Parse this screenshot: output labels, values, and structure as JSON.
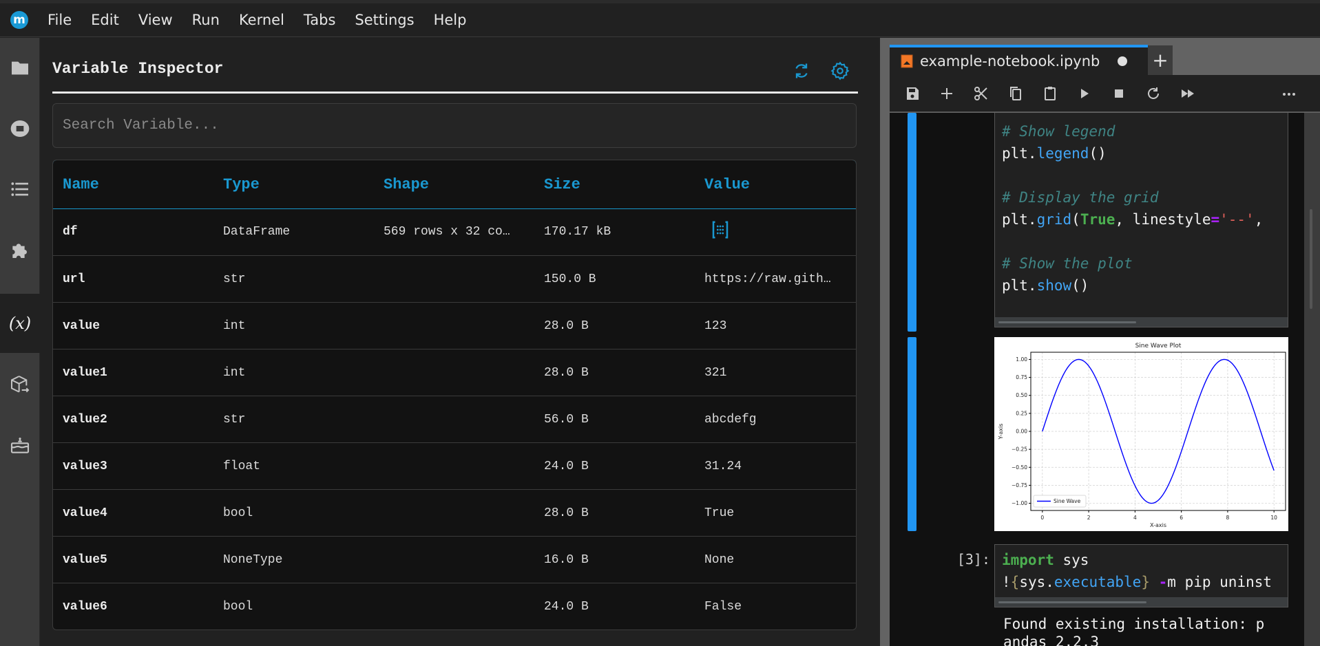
{
  "app": {
    "logo_letter": "m",
    "menu": [
      "File",
      "Edit",
      "View",
      "Run",
      "Kernel",
      "Tabs",
      "Settings",
      "Help"
    ]
  },
  "activity_bar": {
    "items": [
      {
        "icon": "folder-icon",
        "active": false
      },
      {
        "icon": "running-stop-icon",
        "active": false
      },
      {
        "icon": "table-of-contents-icon",
        "active": false
      },
      {
        "icon": "extension-puzzle-icon",
        "active": false
      },
      {
        "icon": "variable-inspector-icon",
        "label": "(x)",
        "active": true
      },
      {
        "icon": "package-export-icon",
        "active": false
      },
      {
        "icon": "cake-icon",
        "active": false
      }
    ]
  },
  "inspector": {
    "title": "Variable Inspector",
    "search_placeholder": "Search Variable...",
    "search_value": "",
    "accent": "#1a98d0",
    "columns": [
      "Name",
      "Type",
      "Shape",
      "Size",
      "Value"
    ],
    "rows": [
      {
        "name": "df",
        "type": "DataFrame",
        "shape": "569 rows x 32 co…",
        "size": "170.17 kB",
        "value": "",
        "value_icon": "matrix-icon"
      },
      {
        "name": "url",
        "type": "str",
        "shape": "",
        "size": "150.0 B",
        "value": "https://raw.gith…"
      },
      {
        "name": "value",
        "type": "int",
        "shape": "",
        "size": "28.0 B",
        "value": "123"
      },
      {
        "name": "value1",
        "type": "int",
        "shape": "",
        "size": "28.0 B",
        "value": "321"
      },
      {
        "name": "value2",
        "type": "str",
        "shape": "",
        "size": "56.0 B",
        "value": "abcdefg"
      },
      {
        "name": "value3",
        "type": "float",
        "shape": "",
        "size": "24.0 B",
        "value": "31.24"
      },
      {
        "name": "value4",
        "type": "bool",
        "shape": "",
        "size": "28.0 B",
        "value": "True"
      },
      {
        "name": "value5",
        "type": "NoneType",
        "shape": "",
        "size": "16.0 B",
        "value": "None"
      },
      {
        "name": "value6",
        "type": "bool",
        "shape": "",
        "size": "24.0 B",
        "value": "False"
      }
    ]
  },
  "notebook": {
    "tab_label": "example-notebook.ipynb",
    "tab_unsaved": true,
    "add_tab_label": "+",
    "toolbar": [
      "save",
      "insert-cell",
      "cut",
      "copy",
      "paste",
      "run",
      "stop",
      "restart",
      "run-all",
      "more"
    ],
    "cell1_code": [
      {
        "parts": [
          {
            "t": "# Show legend",
            "c": "comment"
          }
        ]
      },
      {
        "parts": [
          {
            "t": "plt.",
            "c": ""
          },
          {
            "t": "legend",
            "c": "prop"
          },
          {
            "t": "()",
            "c": ""
          }
        ]
      },
      {
        "parts": [
          {
            "t": "",
            "c": ""
          }
        ]
      },
      {
        "parts": [
          {
            "t": "# Display the grid",
            "c": "comment"
          }
        ]
      },
      {
        "parts": [
          {
            "t": "plt.",
            "c": ""
          },
          {
            "t": "grid",
            "c": "prop"
          },
          {
            "t": "(",
            "c": ""
          },
          {
            "t": "True",
            "c": "kw"
          },
          {
            "t": ", linestyle",
            "c": ""
          },
          {
            "t": "=",
            "c": "op"
          },
          {
            "t": "'--'",
            "c": "str"
          },
          {
            "t": ",",
            "c": ""
          }
        ]
      },
      {
        "parts": [
          {
            "t": "",
            "c": ""
          }
        ]
      },
      {
        "parts": [
          {
            "t": "# Show the plot",
            "c": "comment"
          }
        ]
      },
      {
        "parts": [
          {
            "t": "plt.",
            "c": ""
          },
          {
            "t": "show",
            "c": "prop"
          },
          {
            "t": "()",
            "c": ""
          }
        ]
      }
    ],
    "cell3_prompt": "[3]:",
    "cell3_code": [
      {
        "parts": [
          {
            "t": "import",
            "c": "kw"
          },
          {
            "t": " sys",
            "c": ""
          }
        ]
      },
      {
        "parts": [
          {
            "t": "!",
            "c": ""
          },
          {
            "t": "{",
            "c": "brace"
          },
          {
            "t": "sys.",
            "c": ""
          },
          {
            "t": "executable",
            "c": "prop"
          },
          {
            "t": "}",
            "c": "brace"
          },
          {
            "t": " ",
            "c": ""
          },
          {
            "t": "-",
            "c": "op"
          },
          {
            "t": "m pip uninst",
            "c": ""
          }
        ]
      }
    ],
    "cell3_output": [
      "Found existing installation: p",
      "andas 2.2.3"
    ]
  },
  "chart_data": {
    "type": "line",
    "title": "Sine Wave Plot",
    "xlabel": "X-axis",
    "ylabel": "Y-axis",
    "xlim": [
      -0.5,
      10.5
    ],
    "ylim": [
      -1.1,
      1.1
    ],
    "xticks": [
      0,
      2,
      4,
      6,
      8,
      10
    ],
    "yticks": [
      -1.0,
      -0.75,
      -0.5,
      -0.25,
      0.0,
      0.25,
      0.5,
      0.75,
      1.0
    ],
    "ytick_labels": [
      "−1.00",
      "−0.75",
      "−0.50",
      "−0.25",
      "0.00",
      "0.25",
      "0.50",
      "0.75",
      "1.00"
    ],
    "grid": true,
    "grid_style": "dashed",
    "legend": {
      "entries": [
        "Sine Wave"
      ],
      "position": "lower-left"
    },
    "series": [
      {
        "name": "Sine Wave",
        "function": "sin(x)",
        "color": "#0000ff",
        "x_range": [
          0,
          10
        ],
        "x": [
          0,
          0.5,
          1,
          1.5,
          2,
          2.5,
          3,
          3.5,
          4,
          4.5,
          5,
          5.5,
          6,
          6.5,
          7,
          7.5,
          8,
          8.5,
          9,
          9.5,
          10
        ],
        "y": [
          0,
          0.479,
          0.841,
          0.997,
          0.909,
          0.598,
          0.141,
          -0.351,
          -0.757,
          -0.978,
          -0.959,
          -0.706,
          -0.279,
          0.215,
          0.657,
          0.938,
          0.989,
          0.798,
          0.412,
          -0.075,
          -0.544
        ]
      }
    ]
  }
}
